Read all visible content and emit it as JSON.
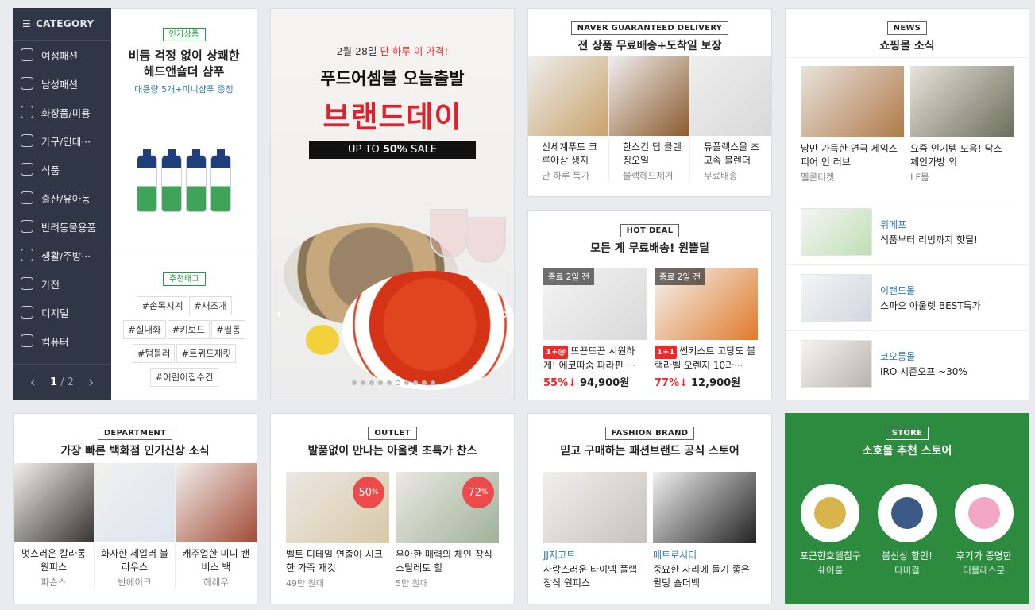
{
  "category": {
    "header": "CATEGORY",
    "items": [
      "여성패션",
      "남성패션",
      "화장품/미용",
      "가구/인테···",
      "식품",
      "출산/유아동",
      "반려동물용품",
      "생활/주방···",
      "가전",
      "디지털",
      "컴퓨터"
    ],
    "icons": [
      "dress-icon",
      "shirt-icon",
      "cosmetics-icon",
      "furniture-icon",
      "food-icon",
      "baby-icon",
      "pet-icon",
      "kitchen-icon",
      "appliance-icon",
      "camera-icon",
      "computer-icon"
    ],
    "page_current": "1",
    "page_total": "/ 2",
    "prev": "‹",
    "next": "›"
  },
  "shampoo": {
    "tag": "인기상품",
    "title_line1": "비듬 걱정 없이 상쾌한",
    "title_line2": "헤드앤숄더 샴푸",
    "promo": "대용량 5개+미니샴푸 증정",
    "tag2": "추천태그",
    "hashtags": [
      "#손목시계",
      "#새조개",
      "#실내화",
      "#키보드",
      "#필통",
      "#텀블러",
      "#트위드재킷",
      "#어린이집수건"
    ]
  },
  "banner": {
    "date": "2월 28일",
    "date_suffix": "단 하루 이 가격!",
    "title": "푸드어셈블 오늘출발",
    "headline": "브랜드데이",
    "sale_prefix": "UP TO ",
    "sale_value": "50%",
    "sale_suffix": " SALE",
    "dot_count": 10,
    "active_dot": 6
  },
  "naver": {
    "tag": "NAVER GUARANTEED DELIVERY",
    "title": "전 상품 무료배송+도착일 보장",
    "items": [
      {
        "name": "신세계푸드 크루아상 생지",
        "sub": "단 하루 특가"
      },
      {
        "name": "한스킨 딥 클렌징오일",
        "sub": "블랙헤드제거"
      },
      {
        "name": "듀플렉스울 초고속 블렌더",
        "sub": "무료배송"
      }
    ]
  },
  "hotdeal": {
    "tag": "HOT DEAL",
    "title": "모든 게 무료배송! 원쁠딜",
    "items": [
      {
        "timer": "종료 2일 전",
        "badge": "1+@",
        "name": "뜨끈뜨끈 시원하게! 에코따숨 파라핀 ···",
        "rate": "55%↓",
        "price": "94,900원"
      },
      {
        "timer": "종료 2일 전",
        "badge": "1+1",
        "name": "썬키스트 고당도 블랙라벨 오렌지 10과···",
        "rate": "77%↓",
        "price": "12,900원"
      }
    ]
  },
  "news": {
    "tag": "NEWS",
    "title": "쇼핑몰 소식",
    "top": [
      {
        "name": "낭만 가득한 연극 세익스피어 인 러브",
        "sub": "멜론티켓"
      },
      {
        "name": "요즘 인기템 모음! 닥스 체인가방 외",
        "sub": "LF몰"
      }
    ],
    "rows": [
      {
        "store": "위메프",
        "desc": "식품부터 리빙까지 핫딜!"
      },
      {
        "store": "이랜드몰",
        "desc": "스파오 아울렛 BEST특가"
      },
      {
        "store": "코오롱몰",
        "desc": "IRO 시즌오프 ~30%"
      }
    ]
  },
  "dept": {
    "tag": "DEPARTMENT",
    "title": "가장 빠른 백화점 인기신상 소식",
    "items": [
      {
        "name": "멋스러운 칼라롱 원피스",
        "sub": "파슨스"
      },
      {
        "name": "화사한 세일러 블라우스",
        "sub": "반에이크"
      },
      {
        "name": "캐주얼한 미니 캔버스 백",
        "sub": "헤레우"
      }
    ]
  },
  "outlet": {
    "tag": "OUTLET",
    "title": "발품없이 만나는 아울렛 초특가 찬스",
    "items": [
      {
        "discount": "50",
        "pct": "%",
        "name": "벨트 디테일 연출이 시크한 가죽 재킷",
        "sub": "49만 원대"
      },
      {
        "discount": "72",
        "pct": "%",
        "name": "우아한 매력의 체인 장식 스틸레토 힐",
        "sub": "5만 원대"
      }
    ]
  },
  "fashion": {
    "tag": "FASHION BRAND",
    "title": "믿고 구매하는 패션브랜드 공식 스토어",
    "items": [
      {
        "brand": "JJ지고트",
        "name": "사랑스러운 타이넥 플랩 장식 원피스"
      },
      {
        "brand": "메트로시티",
        "name": "중요한 자리에 들기 좋은 퀼팅 숄더백"
      }
    ]
  },
  "store": {
    "tag": "STORE",
    "title": "소호몰 추천 스토어",
    "items": [
      {
        "name": "포근한호텔침구",
        "sub": "쉐어룸"
      },
      {
        "name": "봄신상 할인!",
        "sub": "다비걸"
      },
      {
        "name": "후기가 증명한",
        "sub": "더블레스문"
      }
    ]
  },
  "colors": {
    "sidebar": "#2f3746",
    "accent_red": "#ec2a2a",
    "store_green": "#2d8b40",
    "tag_green": "#1aa13c",
    "link_blue": "#2f7bb0"
  }
}
